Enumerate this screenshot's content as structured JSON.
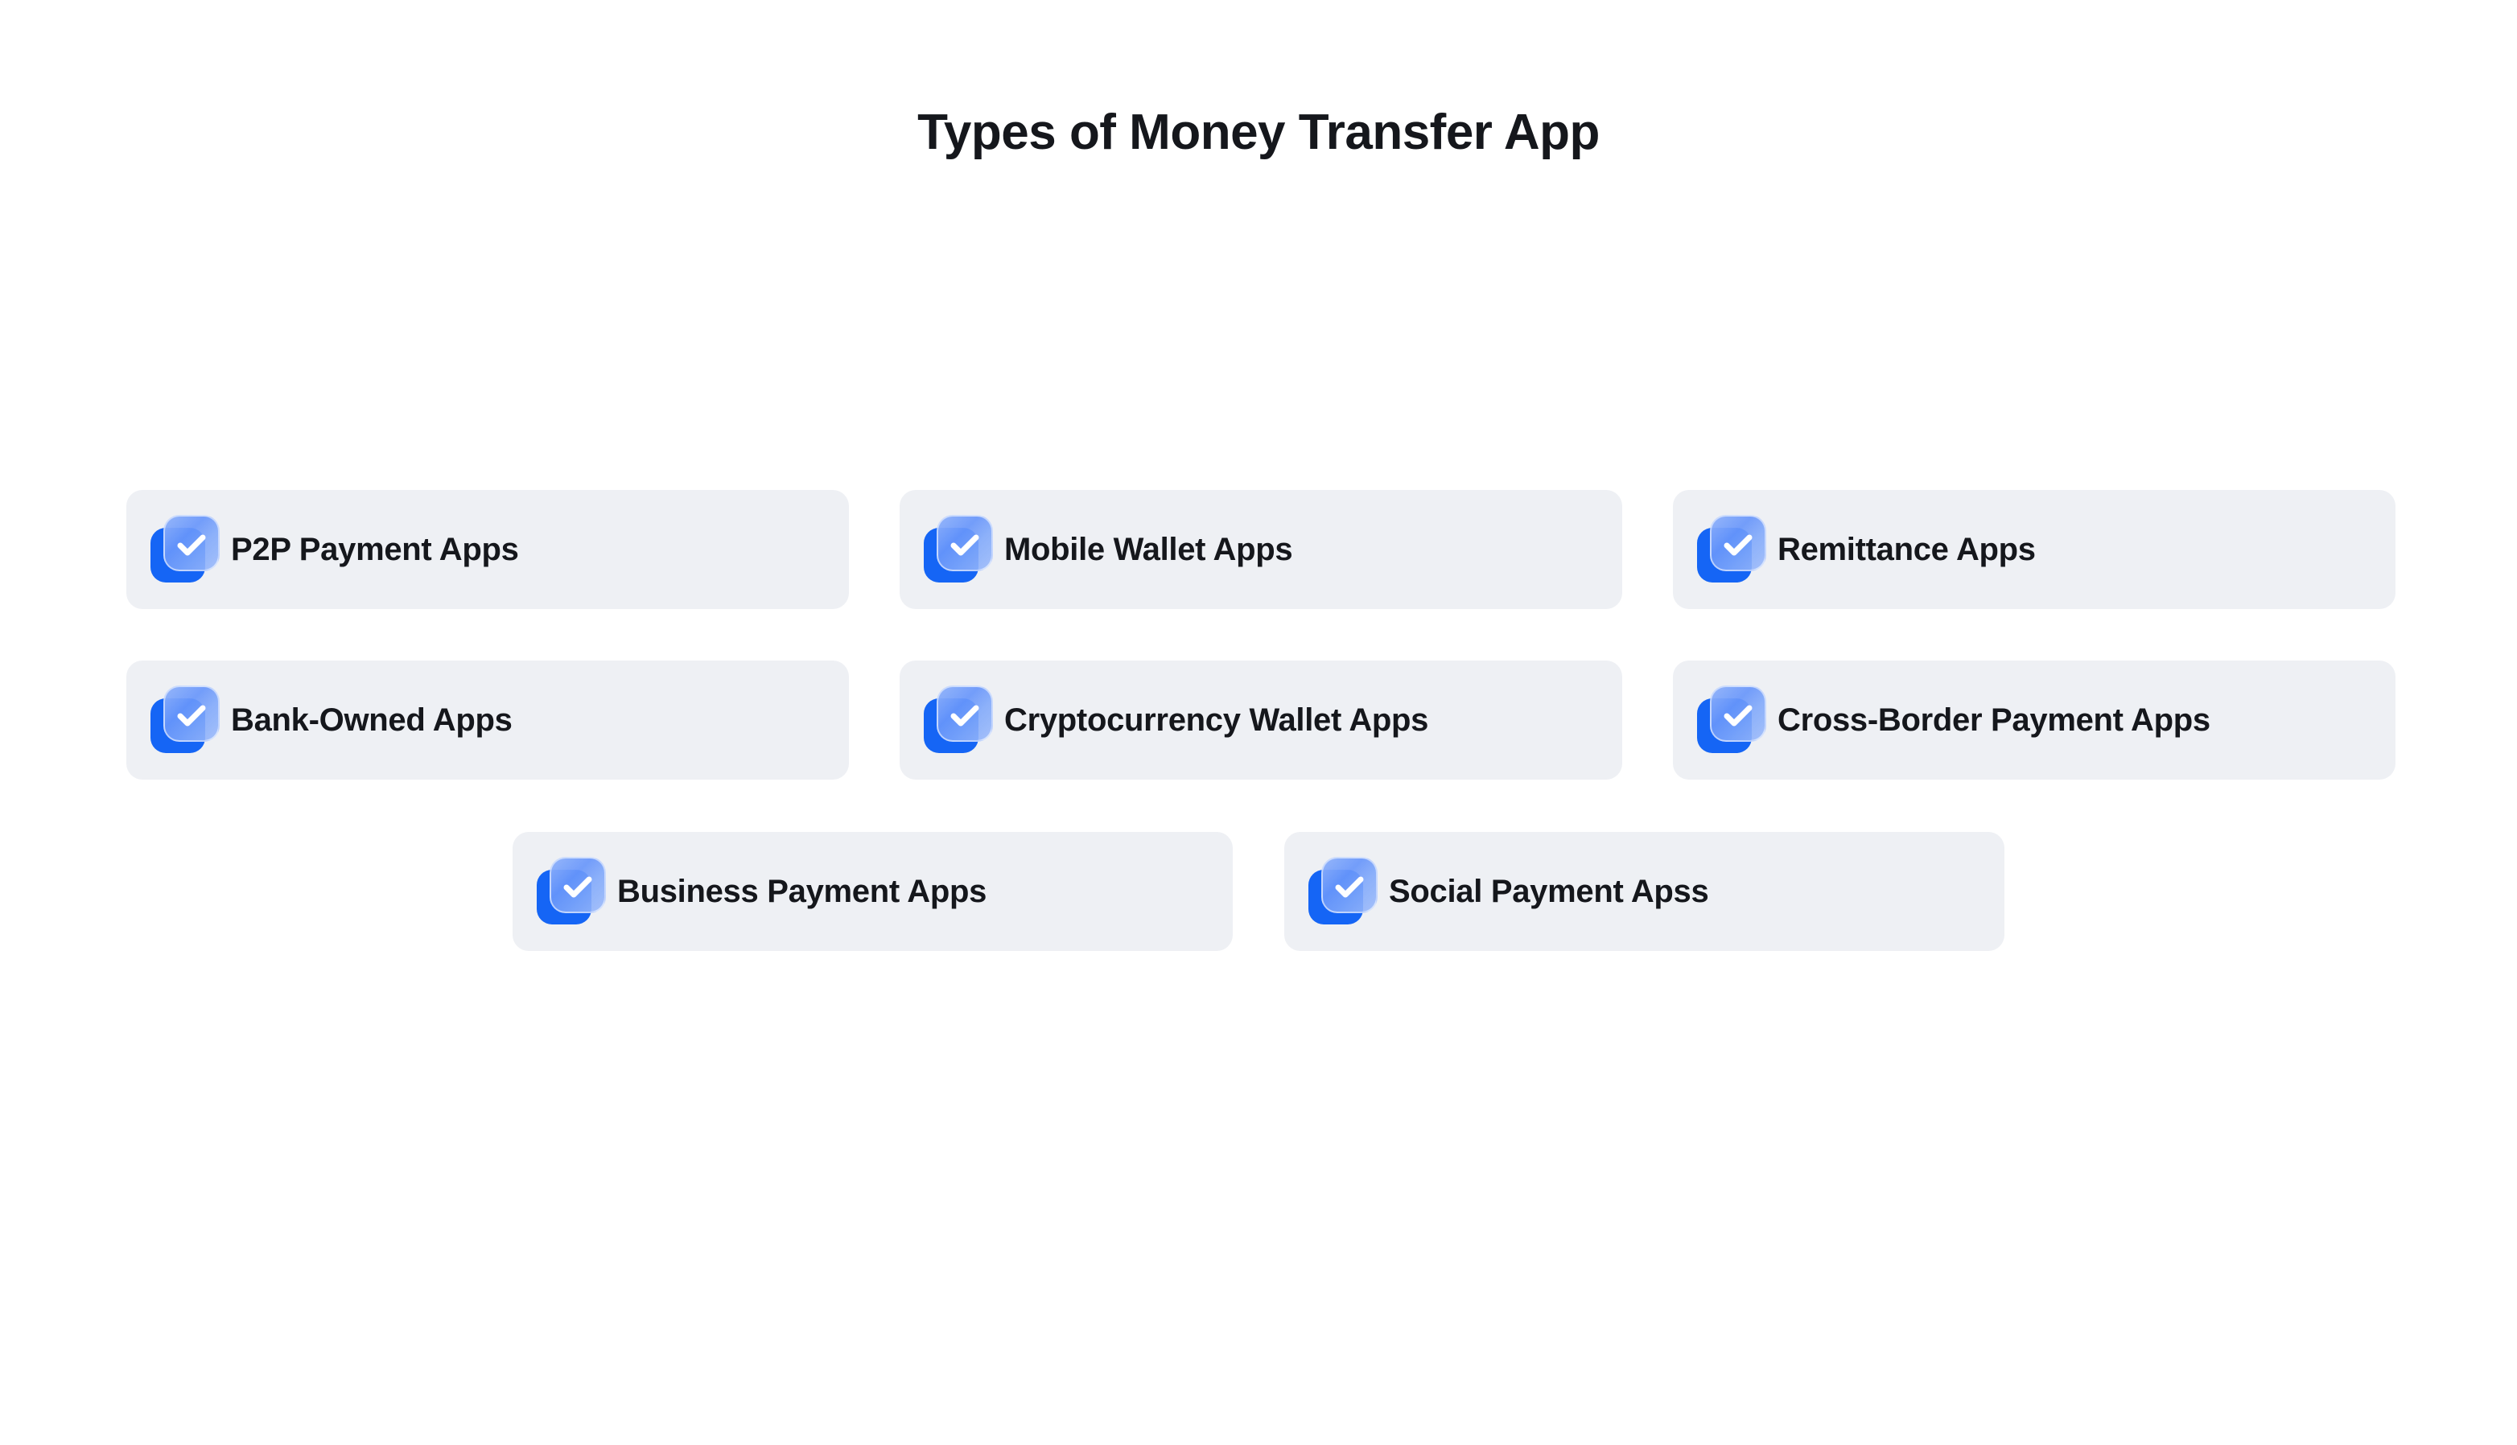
{
  "page": {
    "background_color": "#ffffff",
    "title": "Types of Money Transfer App",
    "title_color": "#15171c"
  },
  "theme": {
    "card_background": "#eef0f4",
    "label_color": "#15171c",
    "icon_back_color": "#1565f5",
    "icon_front_color": "#7ea6fa",
    "check_color": "#ffffff"
  },
  "icon": {
    "name": "checkbox-stack-icon",
    "glyph": "check"
  },
  "rows": [
    {
      "cards": [
        {
          "label": "P2P Payment Apps"
        },
        {
          "label": "Mobile Wallet Apps"
        },
        {
          "label": "Remittance Apps"
        }
      ]
    },
    {
      "cards": [
        {
          "label": "Bank-Owned Apps"
        },
        {
          "label": "Cryptocurrency Wallet Apps"
        },
        {
          "label": "Cross-Border Payment Apps"
        }
      ]
    },
    {
      "cards": [
        {
          "label": "Business Payment Apps"
        },
        {
          "label": "Social Payment Apss"
        }
      ]
    }
  ]
}
